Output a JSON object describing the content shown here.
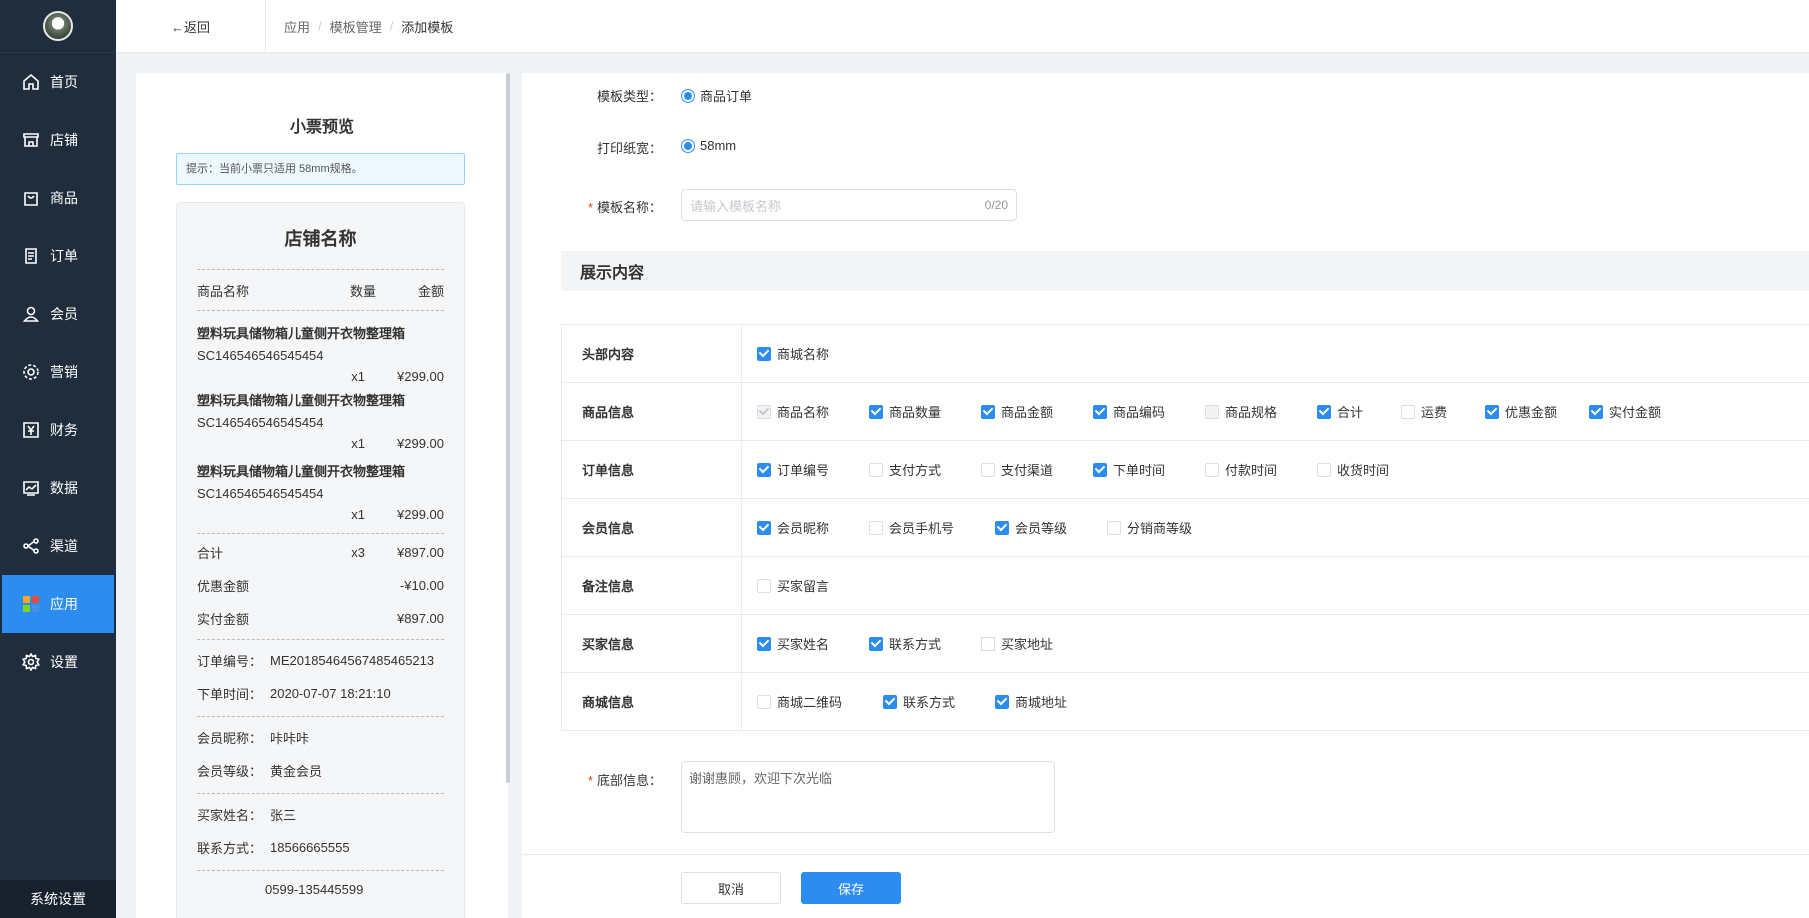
{
  "sidebar": {
    "items": [
      {
        "label": "首页"
      },
      {
        "label": "店铺"
      },
      {
        "label": "商品"
      },
      {
        "label": "订单"
      },
      {
        "label": "会员"
      },
      {
        "label": "营销"
      },
      {
        "label": "财务"
      },
      {
        "label": "数据"
      },
      {
        "label": "渠道"
      },
      {
        "label": "应用",
        "active": true
      },
      {
        "label": "设置"
      }
    ],
    "system_settings": "系统设置"
  },
  "topbar": {
    "back": "←返回",
    "breadcrumb": [
      "应用",
      "模板管理",
      "添加模板"
    ],
    "sep": "/"
  },
  "preview": {
    "title": "小票预览",
    "tip": "提示：当前小票只适用 58mm规格。",
    "shop_name": "店铺名称",
    "header": {
      "name": "商品名称",
      "qty": "数量",
      "amount": "金额"
    },
    "items": [
      {
        "name": "塑料玩具储物箱儿童侧开衣物整理箱",
        "code": "SC146546546545454",
        "qty": "x1",
        "price": "¥299.00"
      },
      {
        "name": "塑料玩具储物箱儿童侧开衣物整理箱",
        "code": "SC146546546545454",
        "qty": "x1",
        "price": "¥299.00"
      },
      {
        "name": "塑料玩具储物箱儿童侧开衣物整理箱",
        "code": "SC146546546545454",
        "qty": "x1",
        "price": "¥299.00"
      }
    ],
    "total": {
      "label": "合计",
      "qty": "x3",
      "amount": "¥897.00"
    },
    "discount": {
      "label": "优惠金额",
      "amount": "-¥10.00"
    },
    "paid": {
      "label": "实付金额",
      "amount": "¥897.00"
    },
    "order_no": {
      "label": "订单编号：",
      "value": "ME20185464567485465213"
    },
    "order_time": {
      "label": "下单时间：",
      "value": "2020-07-07 18:21:10"
    },
    "member_nick": {
      "label": "会员昵称：",
      "value": "咔咔咔"
    },
    "member_level": {
      "label": "会员等级：",
      "value": "黄金会员"
    },
    "buyer_name": {
      "label": "买家姓名：",
      "value": "张三"
    },
    "buyer_phone": {
      "label": "联系方式：",
      "value": "18566665555"
    },
    "cut_text": "0599-135445599"
  },
  "form": {
    "template_type": {
      "label": "模板类型：",
      "option": "商品订单"
    },
    "paper_width": {
      "label": "打印纸宽：",
      "option": "58mm"
    },
    "template_name": {
      "label": "模板名称：",
      "placeholder": "请输入模板名称",
      "count": "0/20"
    },
    "section_title": "展示内容",
    "rows": [
      {
        "category": "头部内容",
        "options": [
          {
            "label": "商城名称",
            "state": "on"
          }
        ]
      },
      {
        "category": "商品信息",
        "options": [
          {
            "label": "商品名称",
            "state": "dison"
          },
          {
            "label": "商品数量",
            "state": "on"
          },
          {
            "label": "商品金额",
            "state": "on"
          },
          {
            "label": "商品编码",
            "state": "on"
          },
          {
            "label": "商品规格",
            "state": "dis"
          },
          {
            "label": "合计",
            "state": "on"
          },
          {
            "label": "运费",
            "state": "off"
          },
          {
            "label": "优惠金额",
            "state": "on"
          },
          {
            "label": "实付金额",
            "state": "on"
          }
        ]
      },
      {
        "category": "订单信息",
        "options": [
          {
            "label": "订单编号",
            "state": "on"
          },
          {
            "label": "支付方式",
            "state": "off"
          },
          {
            "label": "支付渠道",
            "state": "off"
          },
          {
            "label": "下单时间",
            "state": "on"
          },
          {
            "label": "付款时间",
            "state": "off"
          },
          {
            "label": "收货时间",
            "state": "off"
          }
        ]
      },
      {
        "category": "会员信息",
        "options": [
          {
            "label": "会员昵称",
            "state": "on"
          },
          {
            "label": "会员手机号",
            "state": "off"
          },
          {
            "label": "会员等级",
            "state": "on"
          },
          {
            "label": "分销商等级",
            "state": "off"
          }
        ]
      },
      {
        "category": "备注信息",
        "options": [
          {
            "label": "买家留言",
            "state": "off"
          }
        ]
      },
      {
        "category": "买家信息",
        "options": [
          {
            "label": "买家姓名",
            "state": "on"
          },
          {
            "label": "联系方式",
            "state": "on"
          },
          {
            "label": "买家地址",
            "state": "off"
          }
        ]
      },
      {
        "category": "商城信息",
        "options": [
          {
            "label": "商城二维码",
            "state": "off"
          },
          {
            "label": "联系方式",
            "state": "on"
          },
          {
            "label": "商城地址",
            "state": "on"
          }
        ]
      }
    ],
    "footer_info": {
      "label": "底部信息：",
      "value": "谢谢惠顾，欢迎下次光临"
    },
    "cancel": "取消",
    "save": "保存"
  },
  "colors": {
    "primary": "#2d8cf0",
    "sidebar": "#1f2d3d",
    "required": "#ed4014"
  }
}
